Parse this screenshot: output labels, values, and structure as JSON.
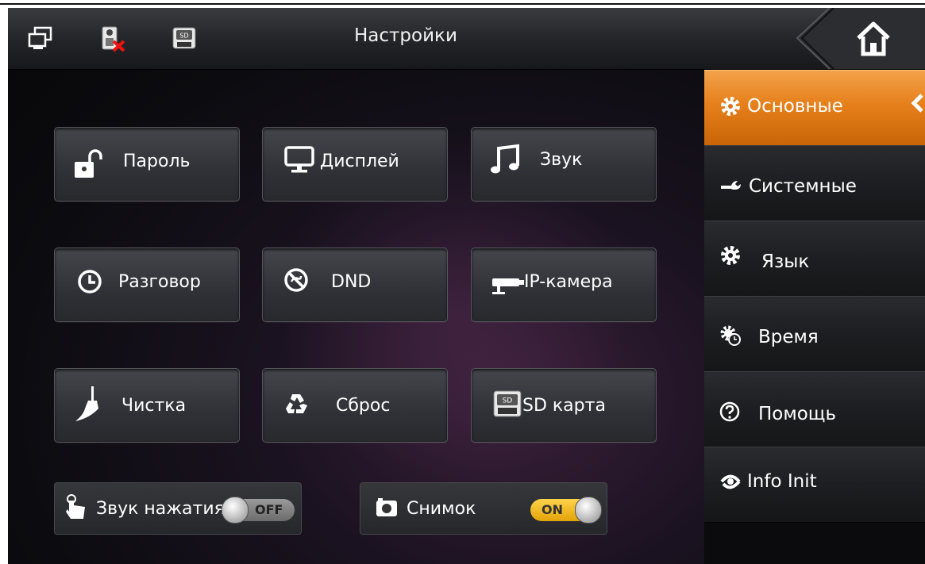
{
  "header": {
    "title": "Настройки",
    "status_icons": [
      "network-icon",
      "door-unit-offline-icon",
      "sd-card-icon"
    ],
    "home_icon": "home-icon"
  },
  "tiles": [
    {
      "label": "Пароль",
      "icon": "padlock-open-icon"
    },
    {
      "label": "Дисплей",
      "icon": "monitor-icon"
    },
    {
      "label": "Звук",
      "icon": "music-note-icon"
    },
    {
      "label": "Разговор",
      "icon": "clock-icon"
    },
    {
      "label": "DND",
      "icon": "do-not-disturb-icon"
    },
    {
      "label": "IP-камера",
      "icon": "ip-camera-icon"
    },
    {
      "label": "Чистка",
      "icon": "broom-icon"
    },
    {
      "label": "Сброс",
      "icon": "recycle-icon"
    },
    {
      "label": "SD карта",
      "icon": "sd-card-icon"
    }
  ],
  "toggles": [
    {
      "label": "Звук нажатия",
      "state": "OFF",
      "icon": "hand-touch-icon"
    },
    {
      "label": "Снимок",
      "state": "ON",
      "icon": "camera-icon"
    }
  ],
  "sidebar": {
    "items": [
      {
        "label": "Основные",
        "icon": "gear-icon",
        "active": true
      },
      {
        "label": "Системные",
        "icon": "wrench-icon",
        "active": false
      },
      {
        "label": "Язык",
        "icon": "gear-icon",
        "active": false
      },
      {
        "label": "Время",
        "icon": "gear-clock-icon",
        "active": false
      },
      {
        "label": "Помощь",
        "icon": "help-icon",
        "active": false
      },
      {
        "label": "Info Init",
        "icon": "eye-refresh-icon",
        "active": false
      }
    ]
  },
  "colors": {
    "accent_orange": "#e6801b",
    "switch_on": "#f2bb25",
    "switch_off": "#8a8a8a",
    "tile_bg": "#35363b",
    "text": "#ffffff"
  }
}
